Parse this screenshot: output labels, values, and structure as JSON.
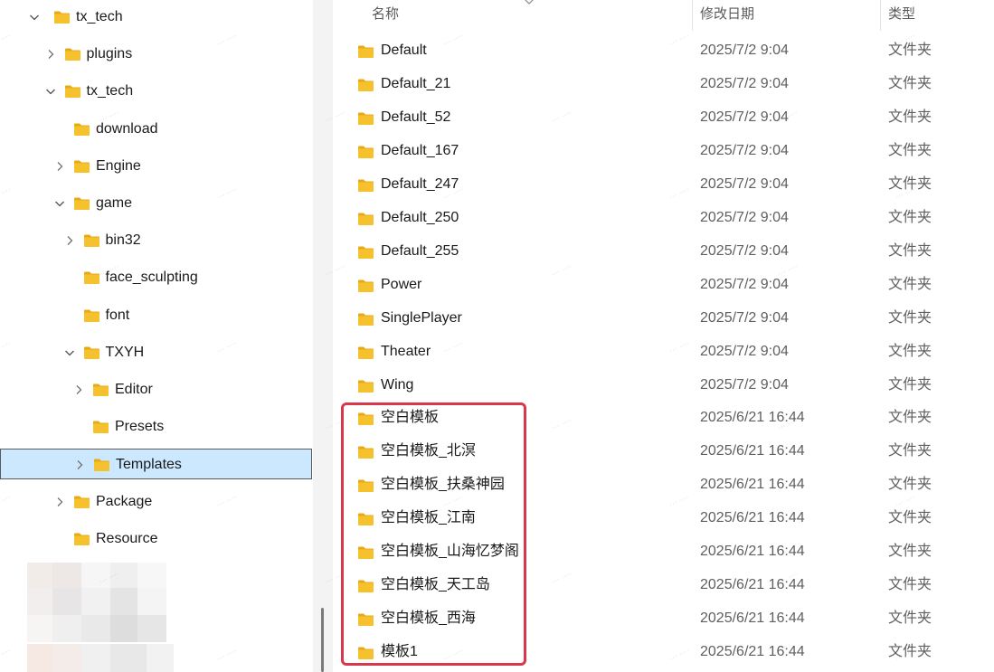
{
  "nav": {
    "items": [
      {
        "label": "tx_tech",
        "depth": 0,
        "expanded": true,
        "has_children": true
      },
      {
        "label": "plugins",
        "depth": 1,
        "expanded": false,
        "has_children": true
      },
      {
        "label": "tx_tech",
        "depth": 1,
        "expanded": true,
        "has_children": true
      },
      {
        "label": "download",
        "depth": 2,
        "expanded": false,
        "has_children": false
      },
      {
        "label": "Engine",
        "depth": 2,
        "expanded": false,
        "has_children": true
      },
      {
        "label": "game",
        "depth": 2,
        "expanded": true,
        "has_children": true
      },
      {
        "label": "bin32",
        "depth": 3,
        "expanded": false,
        "has_children": true
      },
      {
        "label": "face_sculpting",
        "depth": 3,
        "expanded": false,
        "has_children": false
      },
      {
        "label": "font",
        "depth": 3,
        "expanded": false,
        "has_children": false
      },
      {
        "label": "TXYH",
        "depth": 3,
        "expanded": true,
        "has_children": true
      },
      {
        "label": "Editor",
        "depth": 4,
        "expanded": false,
        "has_children": true
      },
      {
        "label": "Presets",
        "depth": 4,
        "expanded": false,
        "has_children": false
      },
      {
        "label": "Templates",
        "depth": 4,
        "expanded": false,
        "has_children": true,
        "selected": true
      },
      {
        "label": "Package",
        "depth": 2,
        "expanded": false,
        "has_children": true
      },
      {
        "label": "Resource",
        "depth": 2,
        "expanded": false,
        "has_children": false
      }
    ]
  },
  "columns": {
    "name": "名称",
    "modified": "修改日期",
    "type": "类型"
  },
  "files": [
    {
      "name": "Default",
      "modified": "2025/7/2 9:04",
      "type": "文件夹"
    },
    {
      "name": "Default_21",
      "modified": "2025/7/2 9:04",
      "type": "文件夹"
    },
    {
      "name": "Default_52",
      "modified": "2025/7/2 9:04",
      "type": "文件夹"
    },
    {
      "name": "Default_167",
      "modified": "2025/7/2 9:04",
      "type": "文件夹"
    },
    {
      "name": "Default_247",
      "modified": "2025/7/2 9:04",
      "type": "文件夹"
    },
    {
      "name": "Default_250",
      "modified": "2025/7/2 9:04",
      "type": "文件夹"
    },
    {
      "name": "Default_255",
      "modified": "2025/7/2 9:04",
      "type": "文件夹"
    },
    {
      "name": "Power",
      "modified": "2025/7/2 9:04",
      "type": "文件夹"
    },
    {
      "name": "SinglePlayer",
      "modified": "2025/7/2 9:04",
      "type": "文件夹"
    },
    {
      "name": "Theater",
      "modified": "2025/7/2 9:04",
      "type": "文件夹"
    },
    {
      "name": "Wing",
      "modified": "2025/7/2 9:04",
      "type": "文件夹"
    },
    {
      "name": "空白模板",
      "modified": "2025/6/21 16:44",
      "type": "文件夹"
    },
    {
      "name": "空白模板_北溟",
      "modified": "2025/6/21 16:44",
      "type": "文件夹"
    },
    {
      "name": "空白模板_扶桑神园",
      "modified": "2025/6/21 16:44",
      "type": "文件夹"
    },
    {
      "name": "空白模板_江南",
      "modified": "2025/6/21 16:44",
      "type": "文件夹"
    },
    {
      "name": "空白模板_山海忆梦阁",
      "modified": "2025/6/21 16:44",
      "type": "文件夹"
    },
    {
      "name": "空白模板_天工岛",
      "modified": "2025/6/21 16:44",
      "type": "文件夹"
    },
    {
      "name": "空白模板_西海",
      "modified": "2025/6/21 16:44",
      "type": "文件夹"
    },
    {
      "name": "模板1",
      "modified": "2025/6/21 16:44",
      "type": "文件夹"
    }
  ],
  "colors": {
    "folder_body": "#f5c22e",
    "folder_tab": "#e8a915",
    "selection": "#cce8ff",
    "highlight_box": "#d9374b"
  },
  "icons": {
    "folder": "folder-icon",
    "expand": "chevron-right-icon",
    "collapse": "chevron-down-icon",
    "sort": "chevron-up-icon"
  }
}
